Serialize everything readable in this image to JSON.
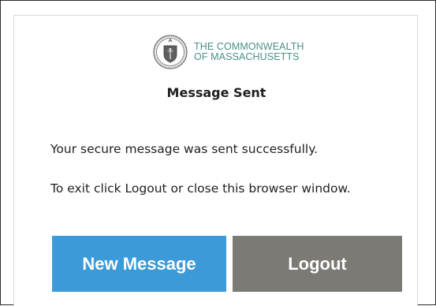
{
  "header": {
    "logo_line1": "THE COMMONWEALTH",
    "logo_line2": "OF MASSACHUSETTS",
    "seal_icon": "massachusetts-seal-icon"
  },
  "dialog": {
    "title": "Message Sent",
    "message_success": "Your secure message was sent successfully.",
    "message_exit": "To exit click Logout or close this browser window."
  },
  "actions": {
    "new_message_label": "New Message",
    "logout_label": "Logout"
  },
  "colors": {
    "brand_teal": "#4a8f87",
    "primary_button": "#3b9ad7",
    "secondary_button": "#7b7a74"
  }
}
